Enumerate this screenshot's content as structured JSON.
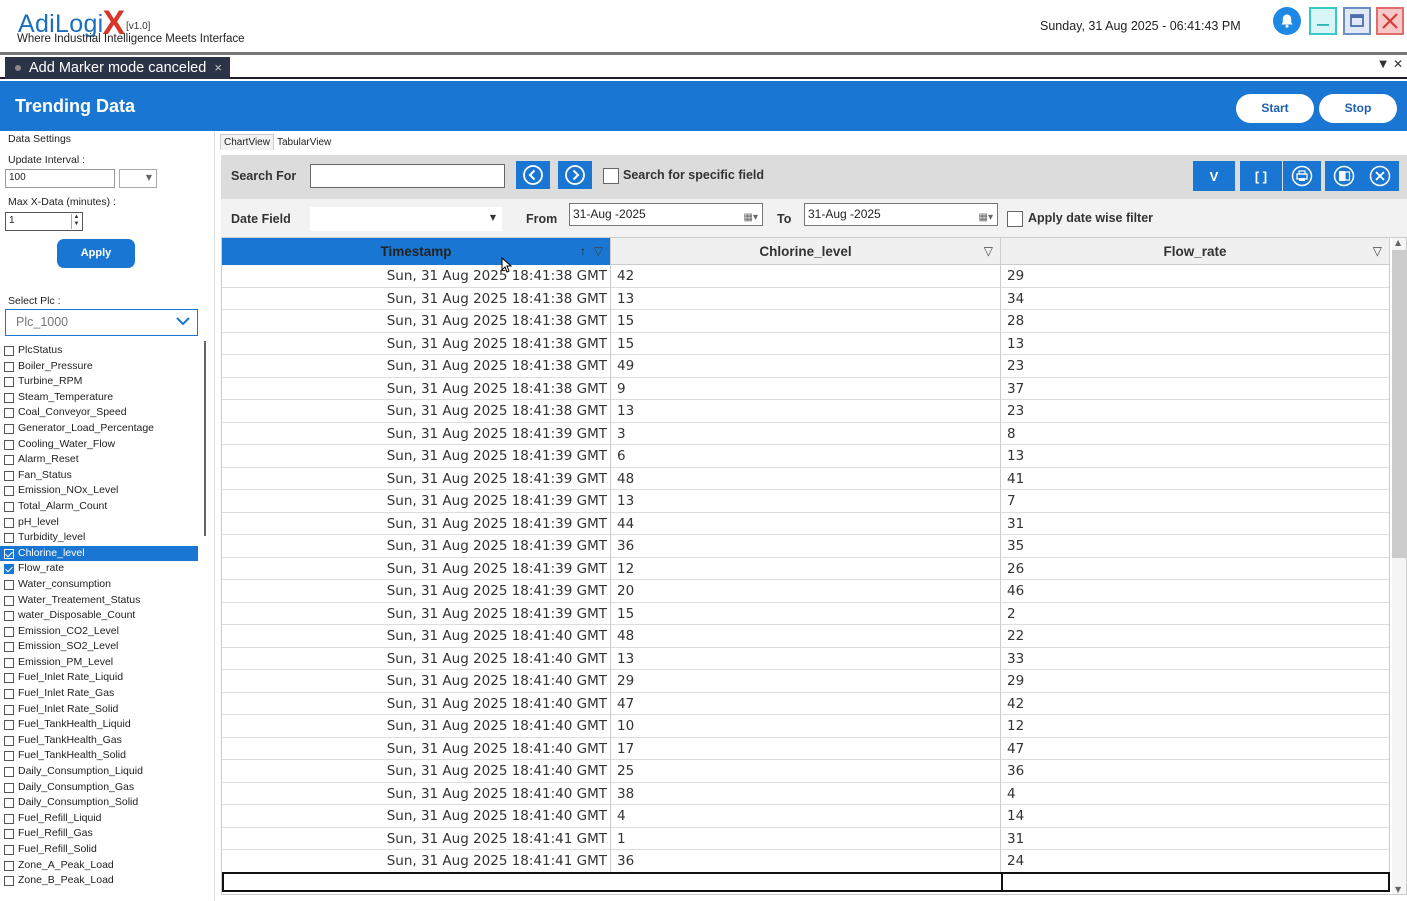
{
  "header": {
    "logo_main": "AdiLogi",
    "logo_x": "X",
    "version": "[v1.0]",
    "tagline": "Where Industrial Intelligence Meets Interface",
    "datetime": "Sunday, 31 Aug 2025 - 06:41:43 PM",
    "icons": [
      "bell-icon",
      "minimize-icon",
      "maximize-icon",
      "close-icon"
    ]
  },
  "tab_strip": {
    "tab_label": "Add Marker mode canceled",
    "close_glyph": "×",
    "menu_glyph": "▼",
    "strip_close_glyph": "✕"
  },
  "title_bar": {
    "title": "Trending Data",
    "start_label": "Start",
    "stop_label": "Stop"
  },
  "left_panel": {
    "data_settings_label": "Data Settings",
    "update_interval_label": "Update Interval :",
    "update_interval_value": "100",
    "max_x_label": "Max X-Data (minutes)  :",
    "max_x_value": "1",
    "apply_label": "Apply",
    "select_plc_label": "Select Plc :",
    "plc_value": "Plc_1000",
    "fields": [
      {
        "name": "PlcStatus",
        "checked": false
      },
      {
        "name": "Boiler_Pressure",
        "checked": false
      },
      {
        "name": "Turbine_RPM",
        "checked": false
      },
      {
        "name": "Steam_Temperature",
        "checked": false
      },
      {
        "name": "Coal_Conveyor_Speed",
        "checked": false
      },
      {
        "name": "Generator_Load_Percentage",
        "checked": false
      },
      {
        "name": "Cooling_Water_Flow",
        "checked": false
      },
      {
        "name": "Alarm_Reset",
        "checked": false
      },
      {
        "name": "Fan_Status",
        "checked": false
      },
      {
        "name": "Emission_NOx_Level",
        "checked": false
      },
      {
        "name": "Total_Alarm_Count",
        "checked": false
      },
      {
        "name": "pH_level",
        "checked": false
      },
      {
        "name": "Turbidity_level",
        "checked": false
      },
      {
        "name": "Chlorine_level",
        "checked": true,
        "selected": true
      },
      {
        "name": "Flow_rate",
        "checked": true
      },
      {
        "name": "Water_consumption",
        "checked": false
      },
      {
        "name": "Water_Treatement_Status",
        "checked": false
      },
      {
        "name": "water_Disposable_Count",
        "checked": false
      },
      {
        "name": "Emission_CO2_Level",
        "checked": false
      },
      {
        "name": "Emission_SO2_Level",
        "checked": false
      },
      {
        "name": "Emission_PM_Level",
        "checked": false
      },
      {
        "name": "Fuel_Inlet Rate_Liquid",
        "checked": false
      },
      {
        "name": "Fuel_Inlet Rate_Gas",
        "checked": false
      },
      {
        "name": "Fuel_Inlet Rate_Solid",
        "checked": false
      },
      {
        "name": "Fuel_TankHealth_Liquid",
        "checked": false
      },
      {
        "name": "Fuel_TankHealth_Gas",
        "checked": false
      },
      {
        "name": "Fuel_TankHealth_Solid",
        "checked": false
      },
      {
        "name": "Daily_Consumption_Liquid",
        "checked": false
      },
      {
        "name": "Daily_Consumption_Gas",
        "checked": false
      },
      {
        "name": "Daily_Consumption_Solid",
        "checked": false
      },
      {
        "name": "Fuel_Refill_Liquid",
        "checked": false
      },
      {
        "name": "Fuel_Refill_Gas",
        "checked": false
      },
      {
        "name": "Fuel_Refill_Solid",
        "checked": false
      },
      {
        "name": "Zone_A_Peak_Load",
        "checked": false
      },
      {
        "name": "Zone_B_Peak_Load",
        "checked": false
      }
    ]
  },
  "view_tabs": {
    "chart": "ChartView",
    "tabular": "TabularView"
  },
  "toolbar": {
    "search_label": "Search For",
    "search_value": "",
    "specific_label": "Search for specific field",
    "v_label": "V",
    "bracket_label": "[ ]",
    "date_field_label": "Date Field",
    "from_label": "From",
    "from_value": "31-Aug -2025",
    "to_label": "To",
    "to_value": "31-Aug -2025",
    "datewise_label": "Apply date wise filter"
  },
  "grid": {
    "columns": [
      "Timestamp",
      "Chlorine_level",
      "Flow_rate"
    ],
    "sort_glyph": "↑",
    "filter_glyph": "▽",
    "rows": [
      [
        "Sun, 31 Aug 2025 18:41:38 GMT",
        "42",
        "29"
      ],
      [
        "Sun, 31 Aug 2025 18:41:38 GMT",
        "13",
        "34"
      ],
      [
        "Sun, 31 Aug 2025 18:41:38 GMT",
        "15",
        "28"
      ],
      [
        "Sun, 31 Aug 2025 18:41:38 GMT",
        "15",
        "13"
      ],
      [
        "Sun, 31 Aug 2025 18:41:38 GMT",
        "49",
        "23"
      ],
      [
        "Sun, 31 Aug 2025 18:41:38 GMT",
        "9",
        "37"
      ],
      [
        "Sun, 31 Aug 2025 18:41:38 GMT",
        "13",
        "23"
      ],
      [
        "Sun, 31 Aug 2025 18:41:39 GMT",
        "3",
        "8"
      ],
      [
        "Sun, 31 Aug 2025 18:41:39 GMT",
        "6",
        "13"
      ],
      [
        "Sun, 31 Aug 2025 18:41:39 GMT",
        "48",
        "41"
      ],
      [
        "Sun, 31 Aug 2025 18:41:39 GMT",
        "13",
        "7"
      ],
      [
        "Sun, 31 Aug 2025 18:41:39 GMT",
        "44",
        "31"
      ],
      [
        "Sun, 31 Aug 2025 18:41:39 GMT",
        "36",
        "35"
      ],
      [
        "Sun, 31 Aug 2025 18:41:39 GMT",
        "12",
        "26"
      ],
      [
        "Sun, 31 Aug 2025 18:41:39 GMT",
        "20",
        "46"
      ],
      [
        "Sun, 31 Aug 2025 18:41:39 GMT",
        "15",
        "2"
      ],
      [
        "Sun, 31 Aug 2025 18:41:40 GMT",
        "48",
        "22"
      ],
      [
        "Sun, 31 Aug 2025 18:41:40 GMT",
        "13",
        "33"
      ],
      [
        "Sun, 31 Aug 2025 18:41:40 GMT",
        "29",
        "29"
      ],
      [
        "Sun, 31 Aug 2025 18:41:40 GMT",
        "47",
        "42"
      ],
      [
        "Sun, 31 Aug 2025 18:41:40 GMT",
        "10",
        "12"
      ],
      [
        "Sun, 31 Aug 2025 18:41:40 GMT",
        "17",
        "47"
      ],
      [
        "Sun, 31 Aug 2025 18:41:40 GMT",
        "25",
        "36"
      ],
      [
        "Sun, 31 Aug 2025 18:41:40 GMT",
        "38",
        "4"
      ],
      [
        "Sun, 31 Aug 2025 18:41:40 GMT",
        "4",
        "14"
      ],
      [
        "Sun, 31 Aug 2025 18:41:41 GMT",
        "1",
        "31"
      ],
      [
        "Sun, 31 Aug 2025 18:41:41 GMT",
        "36",
        "24"
      ]
    ]
  },
  "colors": {
    "primary": "#1976d2",
    "logo_x": "#d9362a",
    "selected_row": "#1976d2"
  }
}
